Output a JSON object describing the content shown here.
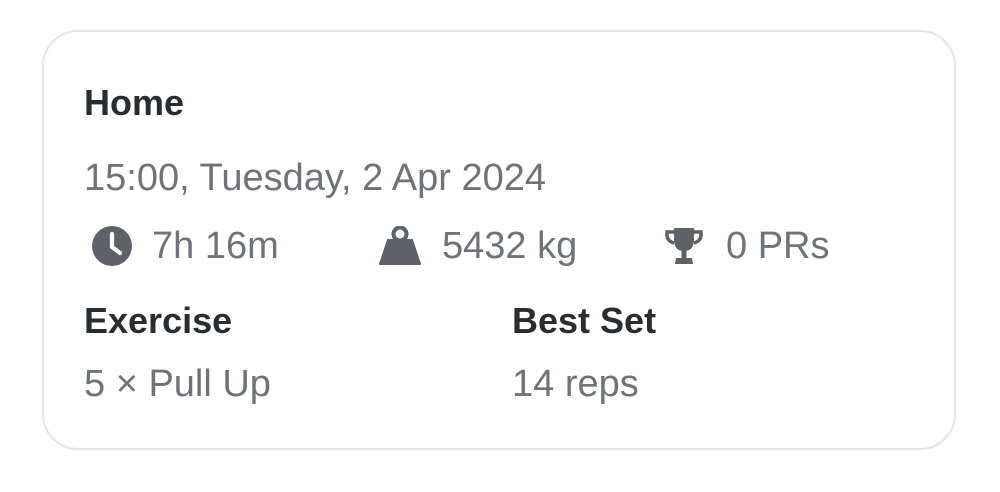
{
  "workout": {
    "title": "Home",
    "datetime": "15:00, Tuesday, 2 Apr 2024",
    "stats": {
      "duration": {
        "icon": "clock-icon",
        "value": "7h 16m"
      },
      "volume": {
        "icon": "weight-icon",
        "value": "5432 kg"
      },
      "prs": {
        "icon": "trophy-icon",
        "value": "0 PRs"
      }
    },
    "table": {
      "headers": [
        "Exercise",
        "Best Set"
      ],
      "rows": [
        [
          "5 × Pull Up",
          "14 reps"
        ]
      ]
    }
  },
  "colors": {
    "title_text": "#2a2d30",
    "secondary_text": "#6f7378",
    "icon": "#5e6266",
    "card_border": "#e6e6e6"
  }
}
